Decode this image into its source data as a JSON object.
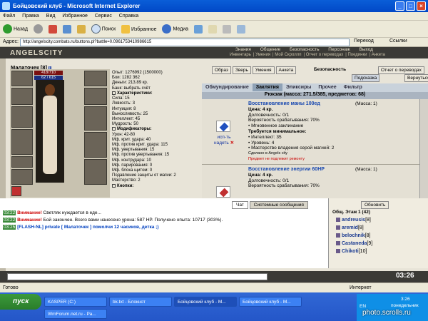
{
  "window": {
    "title": "Бойцовский клуб - Microsoft Internet Explorer"
  },
  "menu": [
    "Файл",
    "Правка",
    "Вид",
    "Избранное",
    "Сервис",
    "Справка"
  ],
  "toolbar": {
    "back": "Назад",
    "search": "Поиск",
    "favorites": "Избранное",
    "media": "Медиа"
  },
  "address": {
    "label": "Адрес:",
    "value": "http://angelscity.combats.ru/buttons.pl?battle=0.0961753410986615",
    "go": "Переход",
    "links": "Ссылки"
  },
  "site": {
    "logo": "ANGELSCITY",
    "main_nav": [
      "Знания",
      "Общение",
      "Безопасность",
      "Персонаж",
      "Выход"
    ],
    "sub_nav": [
      "Инвентарь",
      "Умения",
      "Мой Скроллп",
      "Отчет о переводах",
      "Поединки",
      "Анкета"
    ]
  },
  "character": {
    "name": "Малаточек",
    "level": "[8]",
    "hp": "418/710",
    "mp": "62 / 615",
    "stats_top": [
      "Опыт: 1276992 (1500000)",
      "Бои: 1282 362",
      "Деньги: 213.89 кр.",
      "Банк: выбрать счёт"
    ],
    "characteristics_title": "Характеристики:",
    "characteristics": [
      "Сила: 15",
      "Ловкость: 3",
      "Интуиция: 8",
      "Выносливость: 25",
      "Интеллект: 45",
      "Мудрость: 50"
    ],
    "modifiers_title": "Модификаторы:",
    "modifiers": [
      "Урон: 42-80",
      "Мф. крит. удара: 40",
      "Мф. против крит. удара: 115",
      "Мф. увертывания: 15",
      "Мф. против увертывания: 15",
      "Мф. контрудара: 10",
      "Мф. парирования: 0",
      "Мф. блока щитом: 0",
      "Подавление защиты от магии: 2",
      "Мастерство: 2"
    ],
    "buttons_title": "Кнопки:"
  },
  "actions": [
    "Образ",
    "Зверь",
    "Умения",
    "Анкета"
  ],
  "security": "Безопасность",
  "report_button": "Отчет о переводах",
  "hint_button": "Подсказка",
  "back_button": "Вернуться",
  "inv_tabs": [
    "Обмундирование",
    "Заклятия",
    "Эликсиры",
    "Прочее",
    "Фильтр"
  ],
  "backpack": "Рюкзак (масса: 271.5/385, предметов: 68)",
  "items": [
    {
      "name": "Восстановление маны 100ед",
      "mass": "(Масса: 1)",
      "price": "Цена: 4 кр.",
      "durability": "Долговечность: 0/1",
      "chance": "Вероятность срабатывания: 70%",
      "instant": "• Мгновенное заклинание",
      "req_title": "Требуется минимальное:",
      "reqs": [
        "• Интеллект: 35",
        "• Уровень: 4",
        "• Мастерство владения серой магией: 2"
      ],
      "made": "Сделано в Angels city",
      "warn": "Предмет не подлежит ремонту",
      "use": "исп-ть",
      "wear": "надеть"
    },
    {
      "name": "Восстановление энергии 60HP",
      "mass": "(Масса: 1)",
      "price": "Цена: 4 кр.",
      "durability": "Долговечность: 0/1",
      "chance": "Вероятность срабатывания: 70%"
    }
  ],
  "chat": {
    "tabs": [
      "Чат",
      "Системные сообщения"
    ],
    "lines": [
      {
        "time": "03:22",
        "pre": "Внимание!",
        "text": " Светляк нуждается в еде..."
      },
      {
        "time": "03:22",
        "pre": "Внимание!",
        "text": " Бой закончен. Всего вами нанесено урона: 587 HP. Получено опыта: 10717 (303%)."
      },
      {
        "time": "03:25",
        "pre": "[FLASH-NL]",
        "text": " private [ Малаточек ] помолчи 12 часиков, детка ;)"
      }
    ]
  },
  "online": {
    "refresh": "Обновить",
    "room": "Общ. Этаж 1 (42)",
    "users": [
      {
        "name": "andreusis",
        "level": "[8]"
      },
      {
        "name": "aremid",
        "level": "[8]"
      },
      {
        "name": "belochnik",
        "level": "[8]"
      },
      {
        "name": "Castaneda",
        "level": "[9]"
      },
      {
        "name": "Chikoti",
        "level": "[10]"
      }
    ]
  },
  "clock": "03:26",
  "statusbar": {
    "text": "Готово",
    "zone": "Интернет"
  },
  "taskbar": {
    "start": "пуск",
    "tasks": [
      "KASPER (C:)",
      "bk.txt - Блокнот",
      "Бойцовский клуб - М...",
      "Бойцовский клуб - М...",
      "WmForum.net.ru - Ра..."
    ],
    "lang": "EN",
    "time": "3:26",
    "day": "понедельник"
  },
  "watermark": "photo.scrolls.ru"
}
